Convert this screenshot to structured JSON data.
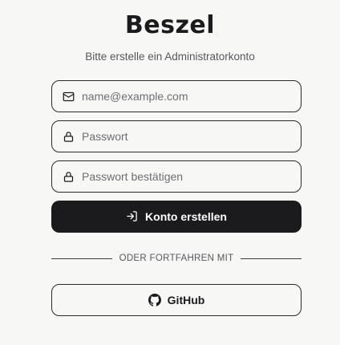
{
  "brand": {
    "name": "Beszel"
  },
  "subtitle": "Bitte erstelle ein Administratorkonto",
  "form": {
    "email": {
      "placeholder": "name@example.com",
      "value": "",
      "icon": "mail-icon"
    },
    "password": {
      "placeholder": "Passwort",
      "value": "",
      "icon": "lock-icon"
    },
    "password_confirm": {
      "placeholder": "Passwort bestätigen",
      "value": "",
      "icon": "lock-icon"
    },
    "submit": {
      "label": "Konto erstellen",
      "icon": "log-in-icon"
    }
  },
  "divider": {
    "label": "ODER FORTFAHREN MIT"
  },
  "oauth": {
    "github": {
      "label": "GitHub",
      "icon": "github-icon"
    }
  },
  "colors": {
    "primary": "#1b1b1d",
    "background": "#f7f7f6",
    "muted_text": "#55575c"
  }
}
